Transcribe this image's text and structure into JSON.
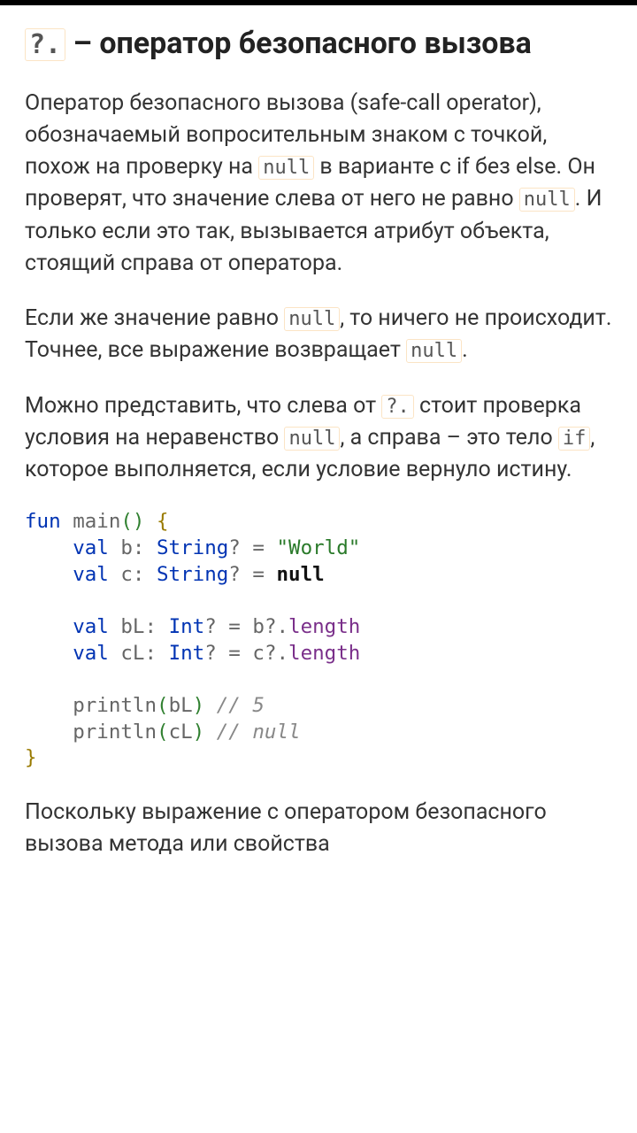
{
  "heading": {
    "op": "?.",
    "rest": " – оператор безопасного вызова"
  },
  "p1": {
    "a": "Оператор безопасного вызова (safe-call operator), обозначаемый вопросительным знаком с точкой, похож на проверку на ",
    "null1": "null",
    "b": " в варианте с if без else. Он проверят, что значение слева от него не равно ",
    "null2": "null",
    "c": ". И только если это так, вызывается атрибут объекта, стоящий справа от оператора."
  },
  "p2": {
    "a": "Если же значение равно ",
    "null1": "null",
    "b": ", то ничего не происходит. Точнее, все выражение возвращает ",
    "null2": "null",
    "c": "."
  },
  "p3": {
    "a": "Можно представить, что слева от ",
    "op": "?.",
    "b": " стоит проверка условия на неравенство ",
    "null1": "null",
    "c": ", а справа – это тело ",
    "if": "if",
    "d": ", которое выполняется, если условие вернуло истину."
  },
  "code": {
    "l1_fun": "fun ",
    "l1_main": "main",
    "l1_paren": "()",
    "l1_ob": " {",
    "l2_indent": "    ",
    "l2_val": "val ",
    "l2_b": "b",
    "l2_colon": ": ",
    "l2_String": "String",
    "l2_q": "?",
    "l2_eq": " = ",
    "l2_str": "\"World\"",
    "l3_indent": "    ",
    "l3_val": "val ",
    "l3_c": "c",
    "l3_colon": ": ",
    "l3_String": "String",
    "l3_q": "?",
    "l3_eq": " = ",
    "l3_null": "null",
    "l5_indent": "    ",
    "l5_val": "val ",
    "l5_bL": "bL",
    "l5_colon": ": ",
    "l5_Int": "Int",
    "l5_q": "?",
    "l5_eq": " = ",
    "l5_b": "b",
    "l5_op": "?.",
    "l5_len": "length",
    "l6_indent": "    ",
    "l6_val": "val ",
    "l6_cL": "cL",
    "l6_colon": ": ",
    "l6_Int": "Int",
    "l6_q": "?",
    "l6_eq": " = ",
    "l6_c": "c",
    "l6_op": "?.",
    "l6_len": "length",
    "l8_indent": "    ",
    "l8_println": "println",
    "l8_op": "(",
    "l8_arg": "bL",
    "l8_cp": ")",
    "l8_comment": " // 5",
    "l9_indent": "    ",
    "l9_println": "println",
    "l9_op": "(",
    "l9_arg": "cL",
    "l9_cp": ")",
    "l9_comment": " // null",
    "l10_cb": "}"
  },
  "p4": {
    "a": "Поскольку выражение с оператором безопасного вызова метода или свойства"
  }
}
